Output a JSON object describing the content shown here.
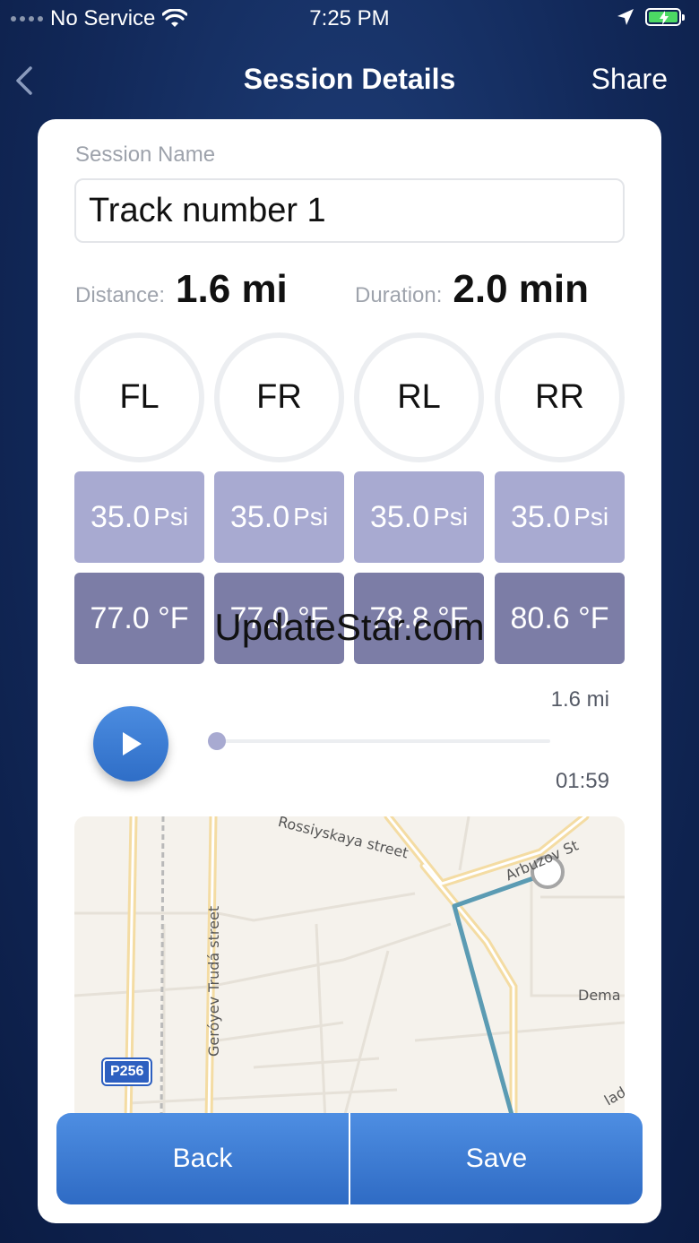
{
  "status_bar": {
    "carrier": "No Service",
    "time": "7:25 PM"
  },
  "nav": {
    "title": "Session Details",
    "share_label": "Share"
  },
  "session": {
    "name_label": "Session Name",
    "name_value": "Track number 1",
    "distance_label": "Distance:",
    "distance_value": "1.6 mi",
    "duration_label": "Duration:",
    "duration_value": "2.0 min"
  },
  "tires": [
    {
      "position": "FL",
      "pressure": "35.0",
      "pressure_unit": "Psi",
      "temperature": "77.0 °F"
    },
    {
      "position": "FR",
      "pressure": "35.0",
      "pressure_unit": "Psi",
      "temperature": "77.0 °F"
    },
    {
      "position": "RL",
      "pressure": "35.0",
      "pressure_unit": "Psi",
      "temperature": "78.8 °F"
    },
    {
      "position": "RR",
      "pressure": "35.0",
      "pressure_unit": "Psi",
      "temperature": "80.6 °F"
    }
  ],
  "watermark": "UpdateStar.com",
  "player": {
    "distance": "1.6 mi",
    "time": "01:59",
    "progress": 0.0
  },
  "map": {
    "streets": [
      "Rossiyskaya street",
      "Arbuzov St",
      "Geróyev Trudá street",
      "Dema",
      "lad"
    ],
    "route_badge": "P256",
    "route_color": "#5b9bb3"
  },
  "buttons": {
    "back_label": "Back",
    "save_label": "Save"
  },
  "colors": {
    "accent": "#3a7bd5",
    "pressure_tile": "#a8aad1",
    "temperature_tile": "#7c7da6"
  }
}
